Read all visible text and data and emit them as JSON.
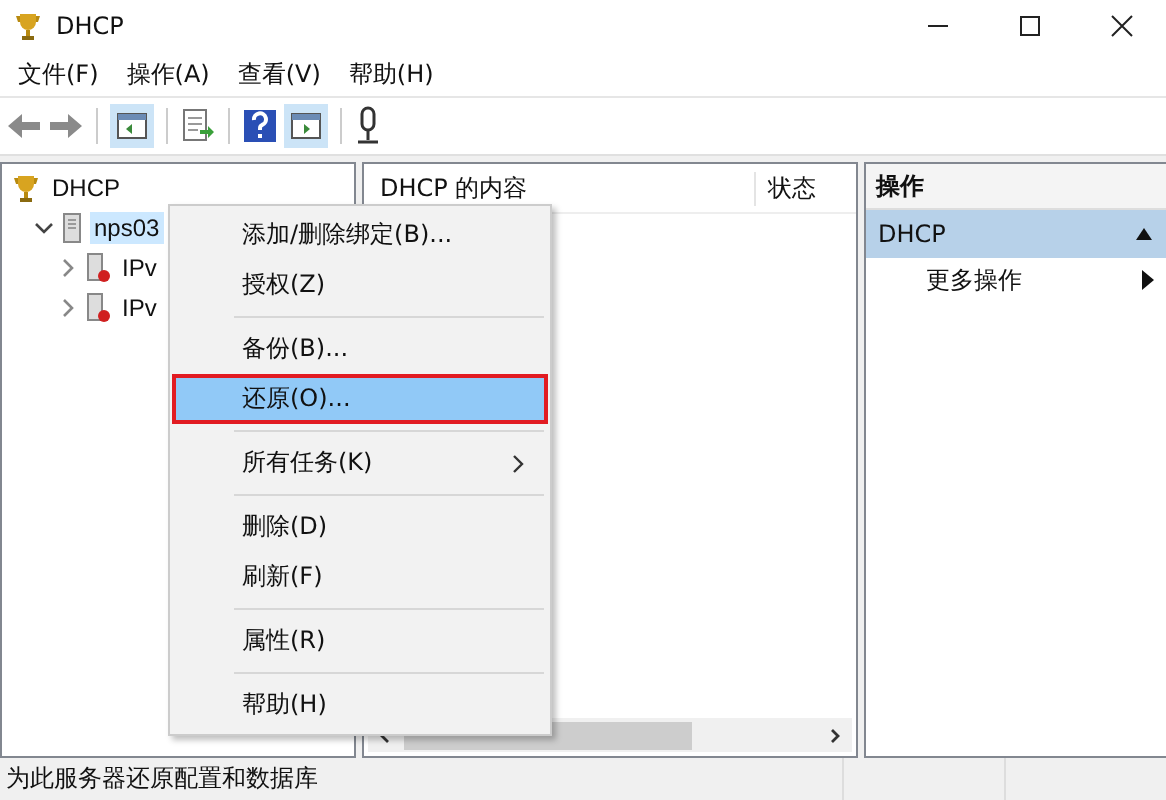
{
  "window": {
    "title": "DHCP"
  },
  "menu_bar": [
    "文件(F)",
    "操作(A)",
    "查看(V)",
    "帮助(H)"
  ],
  "tree": [
    {
      "label": "DHCP",
      "kind": "root",
      "selected": false,
      "children": [
        {
          "label": "nps03",
          "kind": "server",
          "expanded": true,
          "selected": true,
          "children": [
            {
              "label": "IPv",
              "kind": "scope",
              "expanded": false,
              "selected": false
            },
            {
              "label": "IPv",
              "kind": "scope",
              "expanded": false,
              "selected": false
            }
          ]
        }
      ]
    }
  ],
  "content": {
    "columns": [
      "DHCP 的内容",
      "状态"
    ]
  },
  "actions": {
    "header": "操作",
    "section": "DHCP",
    "items": [
      "更多操作"
    ]
  },
  "context_menu": [
    {
      "kind": "item",
      "label": "添加/删除绑定(B)...",
      "selected": false
    },
    {
      "kind": "item",
      "label": "授权(Z)",
      "selected": false
    },
    {
      "kind": "separator"
    },
    {
      "kind": "item",
      "label": "备份(B)...",
      "selected": false
    },
    {
      "kind": "item",
      "label": "还原(O)...",
      "selected": true
    },
    {
      "kind": "separator"
    },
    {
      "kind": "submenu",
      "label": "所有任务(K)",
      "selected": false
    },
    {
      "kind": "separator"
    },
    {
      "kind": "item",
      "label": "删除(D)",
      "selected": false
    },
    {
      "kind": "item",
      "label": "刷新(F)",
      "selected": false
    },
    {
      "kind": "separator"
    },
    {
      "kind": "item",
      "label": "属性(R)",
      "selected": false
    },
    {
      "kind": "separator"
    },
    {
      "kind": "item",
      "label": "帮助(H)",
      "selected": false
    }
  ],
  "status_bar": "为此服务器还原配置和数据库"
}
